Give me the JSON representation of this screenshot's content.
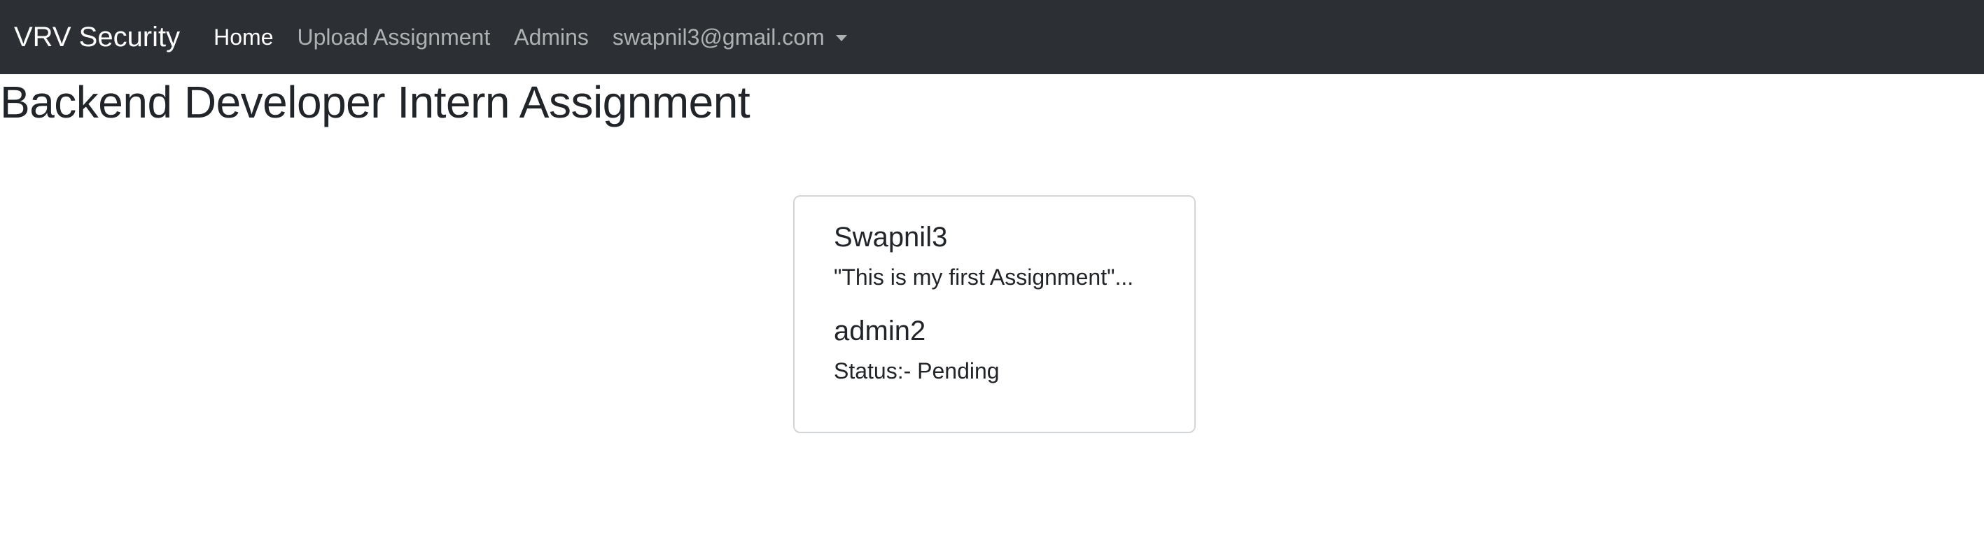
{
  "navbar": {
    "brand": "VRV Security",
    "links": [
      {
        "label": "Home",
        "active": true
      },
      {
        "label": "Upload Assignment",
        "active": false
      },
      {
        "label": "Admins",
        "active": false
      }
    ],
    "user_email": "swapnil3@gmail.com"
  },
  "page": {
    "title": "Backend Developer Intern Assignment"
  },
  "assignment_card": {
    "user_name": "Swapnil3",
    "excerpt": "\"This is my first Assignment\"...",
    "admin_name": "admin2",
    "status": "Status:- Pending"
  },
  "colors": {
    "navbar_bg": "#2c3034",
    "card_border": "#d3d6d9",
    "text": "#212529"
  }
}
